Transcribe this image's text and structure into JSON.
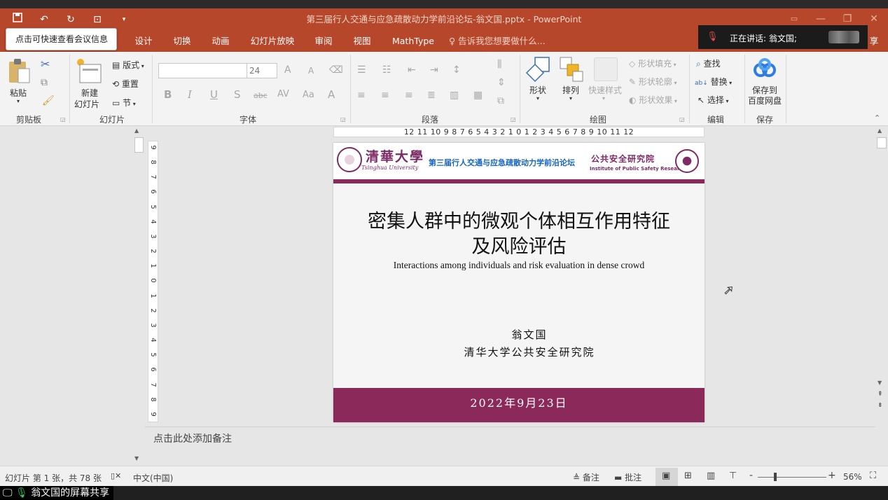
{
  "window": {
    "title": "第三届行人交通与应急疏散动力学前沿论坛-翁文国.pptx - PowerPoint"
  },
  "tooltip": "点击可快速查看会议信息",
  "speaking": "正在讲话: 翁文国;",
  "share_button_partial": "享",
  "tabs": [
    "设计",
    "切换",
    "动画",
    "幻灯片放映",
    "审阅",
    "视图",
    "MathType"
  ],
  "tell_me": "告诉我您想要做什么...",
  "ribbon": {
    "clipboard": {
      "label": "剪贴板",
      "paste": "粘贴"
    },
    "slides": {
      "label": "幻灯片",
      "new_slide_l1": "新建",
      "new_slide_l2": "幻灯片",
      "layout": "版式",
      "reset": "重置",
      "section": "节"
    },
    "font": {
      "label": "字体",
      "size": "24",
      "bold": "B",
      "italic": "I",
      "underline": "U",
      "shadow": "S",
      "strike": "abc",
      "spacing": "AV",
      "case": "Aa",
      "color": "A",
      "grow": "A",
      "shrink": "A"
    },
    "paragraph": {
      "label": "段落"
    },
    "drawing": {
      "label": "绘图",
      "shapes": "形状",
      "arrange": "排列",
      "quick_styles": "快速样式",
      "fill": "形状填充",
      "outline": "形状轮廓",
      "effects": "形状效果"
    },
    "editing": {
      "label": "编辑",
      "find": "查找",
      "replace": "替换",
      "select": "选择"
    },
    "save": {
      "label": "保存",
      "save_to_l1": "保存到",
      "save_to_l2": "百度网盘"
    }
  },
  "ruler": {
    "horizontal": "12 11 10 9 8 7 6 5 4 3 2 1 0 1 2 3 4 5 6 7 8 9 10 11 12",
    "vertical": [
      "9",
      "8",
      "7",
      "6",
      "5",
      "4",
      "3",
      "2",
      "1",
      "0",
      "1",
      "2",
      "3",
      "4",
      "5",
      "6",
      "7",
      "8",
      "9"
    ]
  },
  "slide": {
    "logo_cn": "清華大學",
    "logo_en": "Tsinghua University",
    "forum": "第三届行人交通与应急疏散动力学前沿论坛",
    "inst_cn": "公共安全研究院",
    "inst_en": "Institute of Public Safety Research",
    "title_l1": "密集人群中的微观个体相互作用特征",
    "title_l2": "及风险评估",
    "subtitle": "Interactions among individuals and risk evaluation in dense crowd",
    "author": "翁文国",
    "affiliation": "清华大学公共安全研究院",
    "date": "2022年9月23日"
  },
  "notes_placeholder": "点击此处添加备注",
  "status": {
    "slide_count": "幻灯片 第 1 张，共 78 张",
    "language": "中文(中国)",
    "notes": "备注",
    "comments": "批注",
    "zoom": "56%"
  },
  "screen_share": "翁文国的屏幕共享",
  "colors": {
    "accent": "#b7472a",
    "slide_band": "#8b2a5a",
    "forum_text": "#1565c0"
  }
}
